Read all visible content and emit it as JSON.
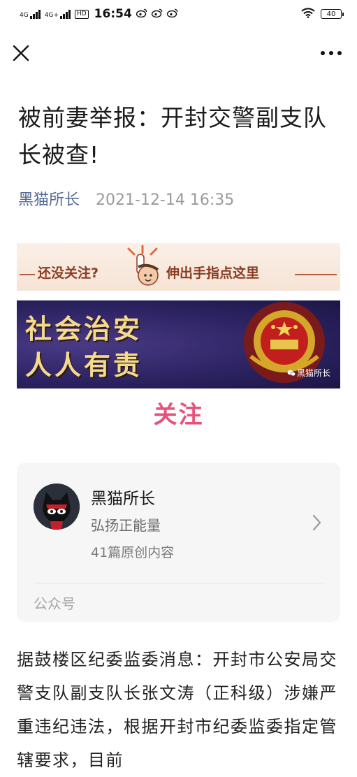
{
  "status_bar": {
    "network_1": "4G",
    "network_2": "4G+",
    "hd_label": "HD",
    "time": "16:54",
    "notification_icons": [
      "weibo-icon",
      "weibo-icon",
      "weibo-icon"
    ],
    "battery": "40"
  },
  "nav": {
    "close_icon": "close-icon",
    "more_icon": "more-icon"
  },
  "article": {
    "title": "被前妻举报：开封交警副支队长被查!",
    "author": "黑猫所长",
    "date": "2021-12-14 16:35"
  },
  "banner": {
    "top_left": "还没关注?",
    "top_right": "伸出手指点这里",
    "line_1": "社会治安",
    "line_2": "人人有责",
    "watermark": "黑猫所长"
  },
  "follow_label": "关注",
  "account_card": {
    "name": "黑猫所长",
    "slogan": "弘扬正能量",
    "count": "41篇原创内容",
    "type": "公众号"
  },
  "body": {
    "paragraph": "据鼓楼区纪委监委消息：开封市公安局交警支队副支队长张文涛（正科级）涉嫌严重违纪违法，根据开封市纪委监委指定管辖要求，目前"
  },
  "colors": {
    "link": "#576b95",
    "follow": "#e8517a"
  }
}
